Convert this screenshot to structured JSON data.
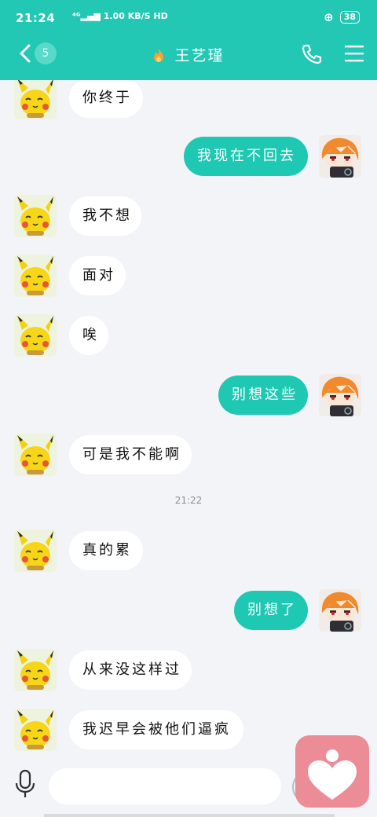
{
  "status_bar": {
    "time": "21:24",
    "net_speed": "1.00 KB/S",
    "hd": "HD",
    "battery": "38"
  },
  "header": {
    "unread_count": "5",
    "contact_name": "王艺瑾",
    "colors": {
      "background": "#22c8b4"
    }
  },
  "messages": [
    {
      "side": "in",
      "text": "你终于"
    },
    {
      "side": "out",
      "text": "我现在不回去"
    },
    {
      "side": "in",
      "text": "我不想"
    },
    {
      "side": "in",
      "text": "面对"
    },
    {
      "side": "in",
      "text": "唉"
    },
    {
      "side": "out",
      "text": "别想这些"
    },
    {
      "side": "in",
      "text": "可是我不能啊"
    },
    {
      "side": "in",
      "text": "真的累"
    },
    {
      "side": "out",
      "text": "别想了"
    },
    {
      "side": "in",
      "text": "从来没这样过"
    },
    {
      "side": "in",
      "text": "我迟早会被他们逼疯"
    }
  ],
  "timestamp": "21:22",
  "input": {
    "value": "",
    "placeholder": ""
  },
  "colors": {
    "outgoing_bubble": "#1fc8b2",
    "incoming_bubble": "#ffffff",
    "chat_background": "#f3f4f8",
    "float_button": "#ec8c96"
  }
}
